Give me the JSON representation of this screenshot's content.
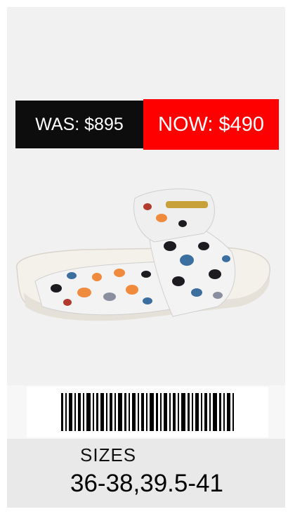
{
  "price": {
    "was": "WAS: $895",
    "now": "NOW: $490"
  },
  "product": {
    "image": "patterned-slide-sandal-image",
    "colors": {
      "sole": "#f4f0ea",
      "strap_base": "#f2f2f2",
      "spots": [
        "#1d1a20",
        "#3b6fa0",
        "#f08a3c",
        "#8a8fa0",
        "#b23a2e"
      ],
      "buckle": "#c9a13a"
    }
  },
  "barcode": {
    "icon": "barcode-icon"
  },
  "sizes": {
    "label": "SIZES",
    "value": "36-38,39.5-41"
  }
}
